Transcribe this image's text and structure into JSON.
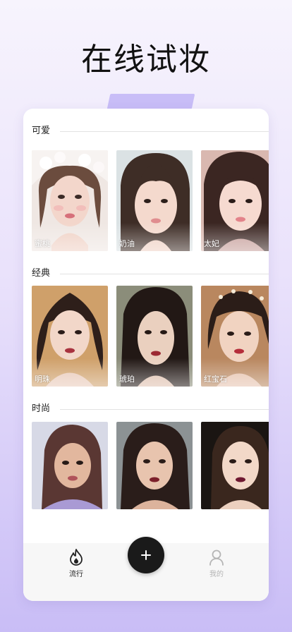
{
  "headline": "在线试妆",
  "sections": [
    {
      "title": "可爱",
      "items": [
        {
          "label": "蜜桃"
        },
        {
          "label": "奶油"
        },
        {
          "label": "太妃"
        }
      ]
    },
    {
      "title": "经典",
      "items": [
        {
          "label": "明珠"
        },
        {
          "label": "琥珀"
        },
        {
          "label": "红宝石"
        }
      ]
    },
    {
      "title": "时尚",
      "items": [
        {
          "label": ""
        },
        {
          "label": ""
        },
        {
          "label": ""
        }
      ]
    }
  ],
  "tabbar": {
    "tabs": [
      {
        "label": "流行",
        "icon": "flame-icon",
        "active": true
      },
      {
        "label": "我的",
        "icon": "person-icon",
        "active": false
      }
    ],
    "fab_icon": "plus-icon"
  },
  "colors": {
    "accent": "#c8bdf7",
    "fab": "#1a1a1a",
    "active_tab": "#222222",
    "inactive_tab": "#b5b5b5"
  }
}
